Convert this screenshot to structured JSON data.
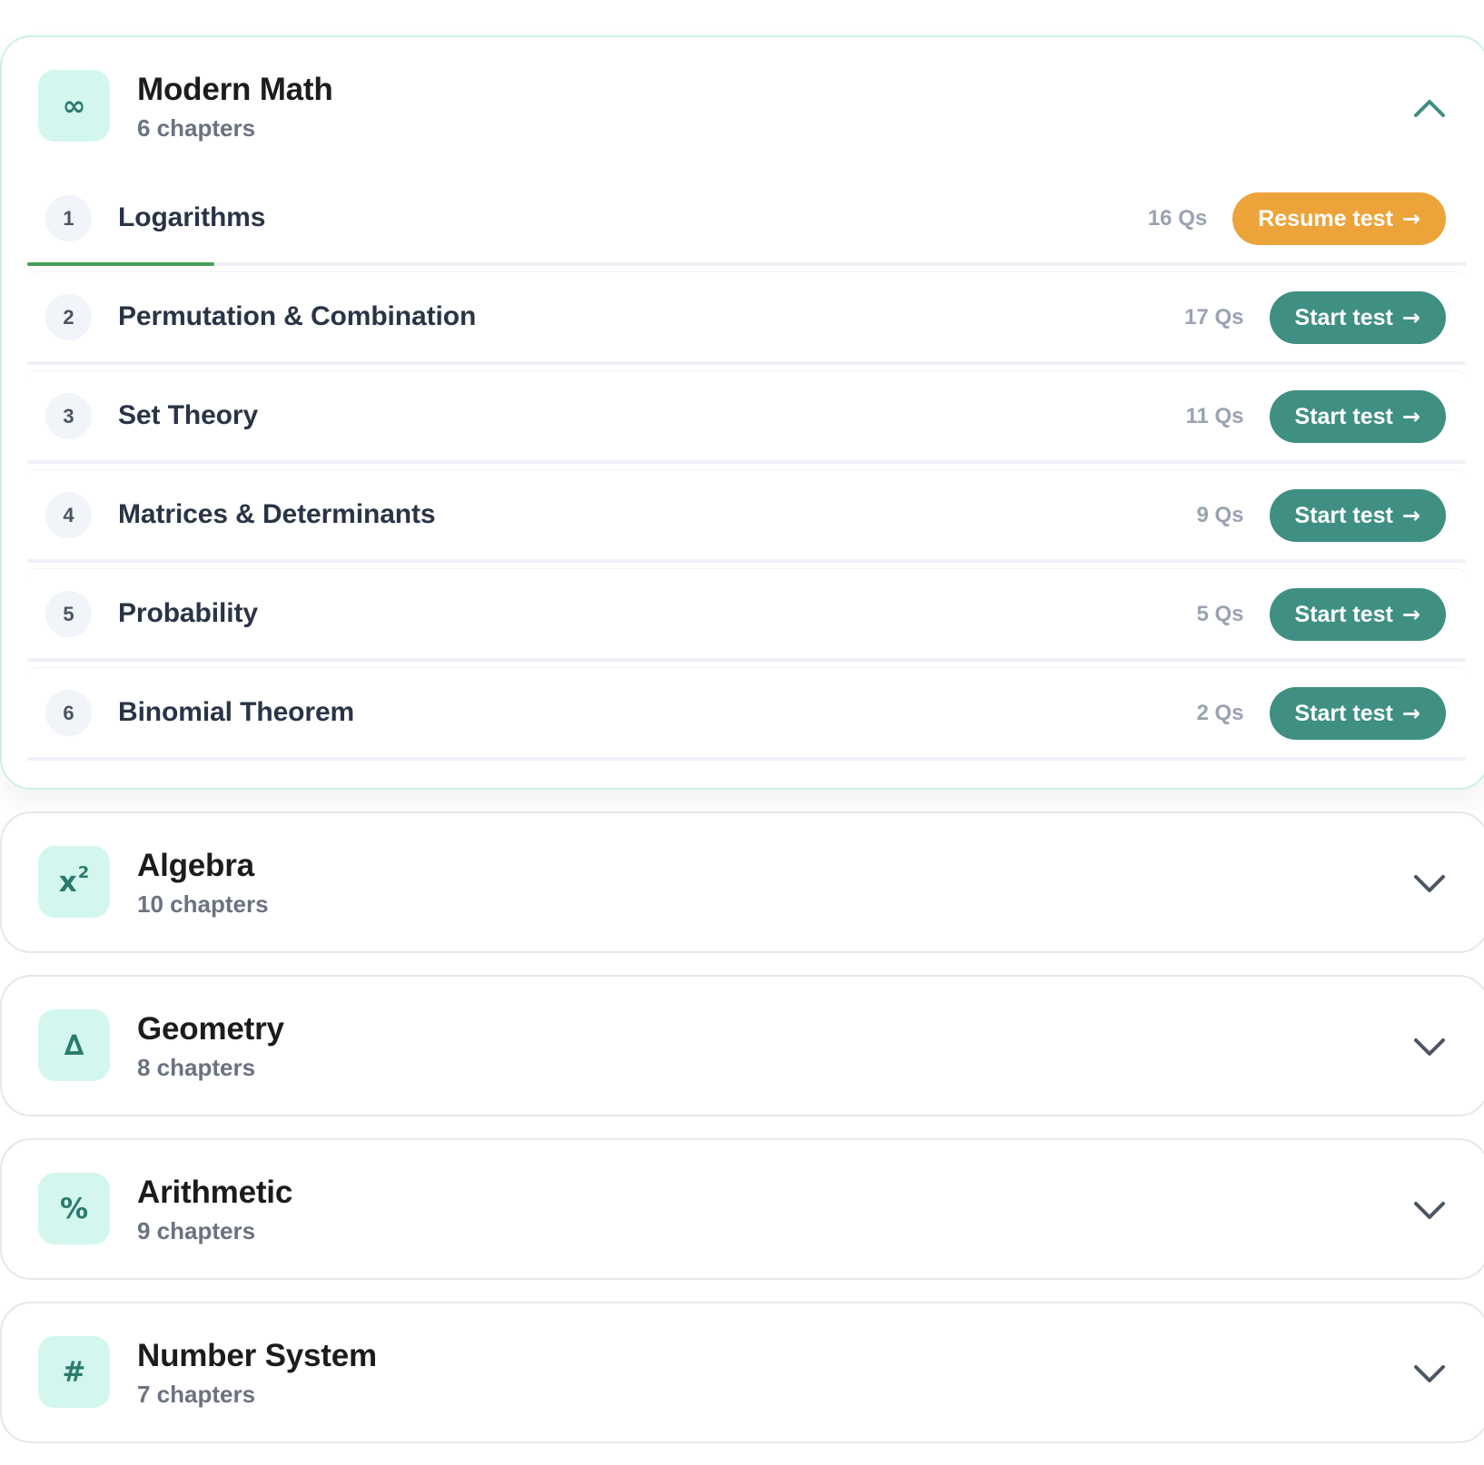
{
  "colors": {
    "start_button": "#3f8f83",
    "resume_button": "#eca43a",
    "progress": "#4a9d58",
    "icon_bg": "#d3f7ee",
    "icon_fg": "#2b7a6e"
  },
  "subjects": [
    {
      "title": "Modern Math",
      "subtitle": "6 chapters",
      "icon": "infinity-icon",
      "icon_glyph": "∞",
      "expanded": true,
      "chapters": [
        {
          "number": "1",
          "name": "Logarithms",
          "qs": "16 Qs",
          "action": "Resume test",
          "status": "resume",
          "progress": 0.13
        },
        {
          "number": "2",
          "name": "Permutation & Combination",
          "qs": "17 Qs",
          "action": "Start test",
          "status": "start"
        },
        {
          "number": "3",
          "name": "Set Theory",
          "qs": "11 Qs",
          "action": "Start test",
          "status": "start"
        },
        {
          "number": "4",
          "name": "Matrices & Determinants",
          "qs": "9 Qs",
          "action": "Start test",
          "status": "start"
        },
        {
          "number": "5",
          "name": "Probability",
          "qs": "5 Qs",
          "action": "Start test",
          "status": "start"
        },
        {
          "number": "6",
          "name": "Binomial Theorem",
          "qs": "2 Qs",
          "action": "Start test",
          "status": "start"
        }
      ]
    },
    {
      "title": "Algebra",
      "subtitle": "10 chapters",
      "icon": "x-squared-icon",
      "icon_glyph": "x",
      "icon_sup": "2",
      "expanded": false
    },
    {
      "title": "Geometry",
      "subtitle": "8 chapters",
      "icon": "triangle-icon",
      "icon_glyph": "∆",
      "expanded": false
    },
    {
      "title": "Arithmetic",
      "subtitle": "9 chapters",
      "icon": "percent-icon",
      "icon_glyph": "%",
      "expanded": false
    },
    {
      "title": "Number System",
      "subtitle": "7 chapters",
      "icon": "hash-icon",
      "icon_glyph": "#",
      "expanded": false
    }
  ]
}
